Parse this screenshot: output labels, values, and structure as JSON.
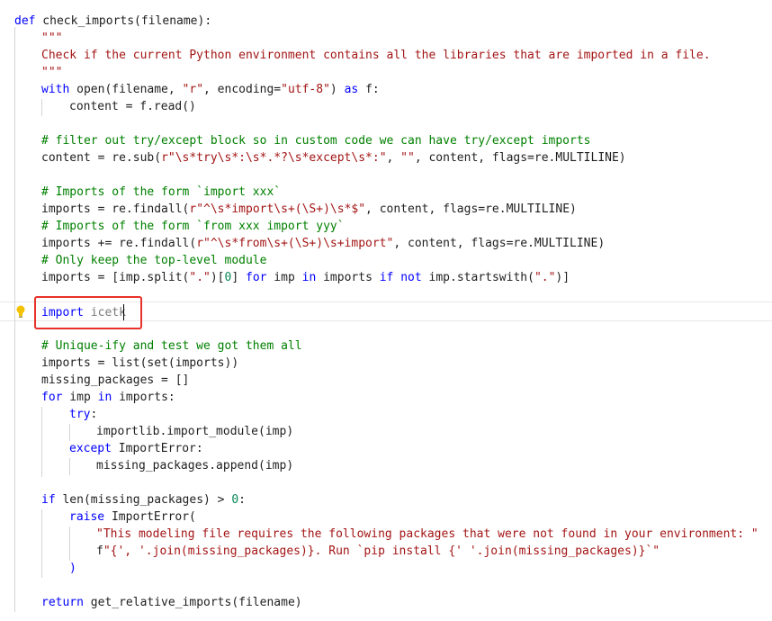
{
  "code": {
    "l1": {
      "kw": "def",
      "rest": " check_imports(filename):"
    },
    "l2": "\"\"\"",
    "l3": "Check if the current Python environment contains all the libraries that are imported in a file.",
    "l4": "\"\"\"",
    "l5": {
      "kw": "with",
      "a": " open(filename, ",
      "s1": "\"r\"",
      "b": ", encoding=",
      "s2": "\"utf-8\"",
      "c": ") ",
      "kw2": "as",
      "d": " f:"
    },
    "l6": "content = f.read()",
    "l8": "# filter out try/except block so in custom code we can have try/except imports",
    "l9": {
      "a": "content = re.sub(",
      "s1": "r\"\\s*try\\s*:\\s*.*?\\s*except\\s*:\"",
      "b": ", ",
      "s2": "\"\"",
      "c": ", content, flags=re.MULTILINE)"
    },
    "l11": "# Imports of the form `import xxx`",
    "l12": {
      "a": "imports = re.findall(",
      "s1": "r\"^\\s*import\\s+(\\S+)\\s*$\"",
      "b": ", content, flags=re.MULTILINE)"
    },
    "l13": "# Imports of the form `from xxx import yyy`",
    "l14": {
      "a": "imports += re.findall(",
      "s1": "r\"^\\s*from\\s+(\\S+)\\s+import\"",
      "b": ", content, flags=re.MULTILINE)"
    },
    "l15": "# Only keep the top-level module",
    "l16": {
      "a": "imports = [imp.split(",
      "s1": "\".\"",
      "b": ")[",
      "n": "0",
      "c": "] ",
      "kw1": "for",
      "d": " imp ",
      "kw2": "in",
      "e": " imports ",
      "kw3": "if",
      "f": " ",
      "kw4": "not",
      "g": " imp.startswith(",
      "s2": "\".\"",
      "h": ")]"
    },
    "l18": {
      "kw": "import",
      "rest": " icetk"
    },
    "l20": "# Unique-ify and test we got them all",
    "l21": "imports = list(set(imports))",
    "l22": "missing_packages = []",
    "l23": {
      "kw": "for",
      "a": " imp ",
      "kw2": "in",
      "b": " imports:"
    },
    "l24": {
      "kw": "try",
      "rest": ":"
    },
    "l25": "importlib.import_module(imp)",
    "l26": {
      "kw": "except",
      "rest": " ImportError:"
    },
    "l27": "missing_packages.append(imp)",
    "l29": {
      "kw": "if",
      "a": " len(missing_packages) > ",
      "n": "0",
      "b": ":"
    },
    "l30": {
      "kw": "raise",
      "rest": " ImportError("
    },
    "l31": "\"This modeling file requires the following packages that were not found in your environment: \"",
    "l32": {
      "a": "f",
      "s": "\"{', '.join(missing_packages)}. Run `pip install {' '.join(missing_packages)}`\""
    },
    "l33": ")",
    "l35": {
      "kw": "return",
      "rest": " get_relative_imports(filename)"
    }
  },
  "colors": {
    "keyword": "#0000ff",
    "string": "#a31515",
    "comment": "#008000",
    "number": "#098658",
    "highlight_box": "#e8312b",
    "lightbulb": "#f2c200"
  },
  "icons": {
    "lightbulb": "lightbulb-icon"
  }
}
